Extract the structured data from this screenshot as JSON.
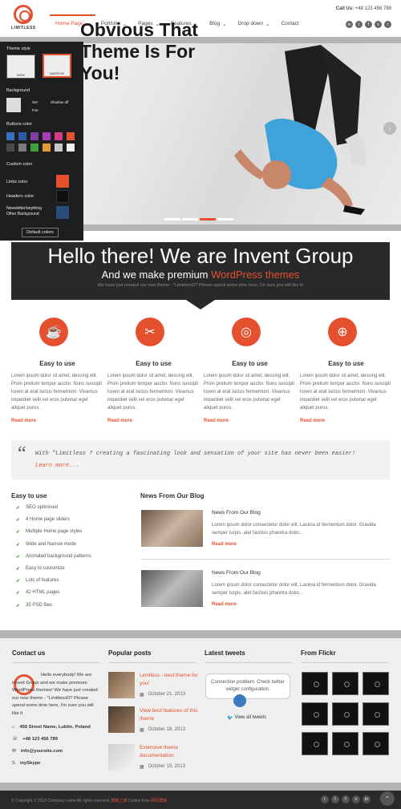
{
  "header": {
    "logo_text": "LIMITLESS",
    "call_label": "Call Us:",
    "call_number": "+48 123 456 789",
    "nav": [
      "Home Page",
      "Portfolio",
      "Pages",
      "Features",
      "Blog",
      "Drop down",
      "Contact"
    ],
    "social_icons": [
      "linkedin-icon",
      "twitter-icon",
      "facebook-icon",
      "vimeo-icon",
      "rss-icon"
    ]
  },
  "hero": {
    "title": "Obvious That Theme Is For You!"
  },
  "style_panel": {
    "theme_style": "Theme style",
    "wide": "WIDE",
    "narrow": "NARROW",
    "background": "Background",
    "background_opts": [
      "Set",
      "Shadow off",
      "Fire"
    ],
    "buttons_color": "Buttons color",
    "button_colors": [
      "#3a6fbf",
      "#2a5aa8",
      "#7b3fa0",
      "#a83fb5",
      "#d43c8a",
      "#e5512f",
      "#4a4a4a",
      "#7a7a7a",
      "#3f9e3a",
      "#e59a2f",
      "#c8c8c8",
      "#f0f0f0"
    ],
    "custom_color": "Custom color",
    "links_color": "Links color",
    "headers_color": "Headers color",
    "other_bg": "Newsletter/anything Other Background",
    "link_swatch": "#e5512f",
    "header_swatch": "#111111",
    "other_swatch": "#2a4d7a",
    "default_btn": "Default colors"
  },
  "banner": {
    "title": "Hello there! We are Invent Group",
    "subtitle_a": "And we make premium ",
    "subtitle_b": "WordPress themes",
    "text": "We have just created our new theme - \"LimitlessD? Please spend some time here, I'm sure you will like it!"
  },
  "features": [
    {
      "icon": "coffee-icon",
      "title": "Easy to use",
      "text": "Lorem ipsum dolor sit amet, descing elit. Proin pretium tempor auctor. Nunc suscipit lorem at erat luctus fermentum. Vivamus imperdiet velit vel eros pulvinar eget aliquet purus.",
      "more": "Read more"
    },
    {
      "icon": "tools-icon",
      "title": "Easy to use",
      "text": "Lorem ipsum dolor sit amet, descing elit. Proin pretium tempor auctor. Nunc suscipit lorem at erat luctus fermentum. Vivamus imperdiet velit vel eros pulvinar eget aliquet purus.",
      "more": "Read more"
    },
    {
      "icon": "target-icon",
      "title": "Easy to use",
      "text": "Lorem ipsum dolor sit amet, descing elit. Proin pretium tempor auctor. Nunc suscipit lorem at erat luctus fermentum. Vivamus imperdiet velit vel eros pulvinar eget aliquet purus.",
      "more": "Read more"
    },
    {
      "icon": "lifebuoy-icon",
      "title": "Easy to use",
      "text": "Lorem ipsum dolor sit amet, descing elit. Proin pretium tempor auctor. Nunc suscipit lorem at erat luctus fermentum. Vivamus imperdiet velit vel eros pulvinar eget aliquet purus.",
      "more": "Read more"
    }
  ],
  "quote": {
    "text": "With \"Limitless ? creating a fascinating look and sensation of your site has never been easier!",
    "more": "Learn more..."
  },
  "easy": {
    "title": "Easy to use",
    "items": [
      "SEO optimised",
      "4 Home page sliders",
      "Multiple Home page styles",
      "Wide and Narrow mode",
      "Animated background patterns",
      "Easy to customize",
      "Lots of features",
      "42 HTML pages",
      "35 PSD files"
    ]
  },
  "blog": {
    "title": "News From Our Blog",
    "posts": [
      {
        "title": "News From Our Blog",
        "text": "Lorem ipsum dolor consectetur dolor elit. Lacinia id fermentum dolor. Gravida semper turpis, alet facilisis pharetra dolor...",
        "more": "Read more"
      },
      {
        "title": "News From Our Blog",
        "text": "Lorem ipsum dolor consectetur dolor elit. Lacinia id fermentum dolor. Gravida semper turpis, alet facilisis pharetra dolor...",
        "more": "Read more"
      }
    ]
  },
  "footer": {
    "contact_title": "Contact us",
    "contact_text": "Hello everybody! We are Invent Group and we make premium WordPress themes! We have just created our new theme - \"LimitlessD? Please spend some time here, I'm sure you will like it",
    "address": "456 Street Name, Lublin, Poland",
    "phone": "+48 123 456 789",
    "email": "info@yoursite.com",
    "skype": "mySkype",
    "popular_title": "Popular posts",
    "popular": [
      {
        "title": "Limitless - best theme for you!",
        "date": "October 21, 2013"
      },
      {
        "title": "View best features of this theme",
        "date": "October 18, 2013"
      },
      {
        "title": "Extensive theme documentation",
        "date": "October 15, 2013"
      }
    ],
    "tweets_title": "Latest tweets",
    "tweet_text": "Connection problem. Check twitter widget configuration.",
    "view_tweets": "View all tweets",
    "flickr_title": "From Flickr",
    "copyright_a": "© Copyright © 2013 Company name All rights reserved. ",
    "copyright_b": "模板之家",
    "copyright_c": " Collect from ",
    "copyright_d": "网页模板"
  }
}
